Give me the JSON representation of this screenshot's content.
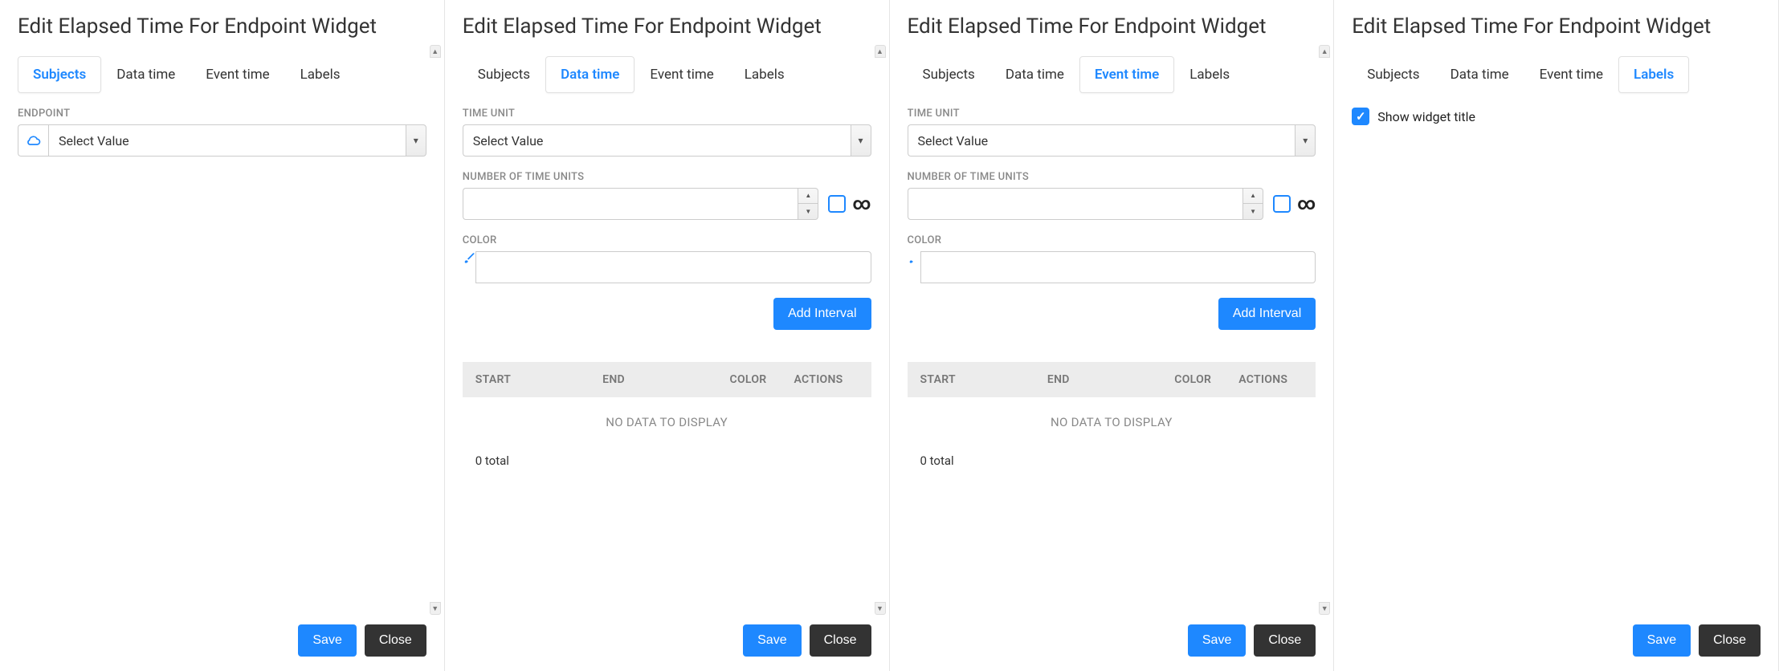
{
  "title": "Edit Elapsed Time For Endpoint Widget",
  "tabs": [
    "Subjects",
    "Data time",
    "Event time",
    "Labels"
  ],
  "panels": [
    {
      "activeTab": 0
    },
    {
      "activeTab": 1
    },
    {
      "activeTab": 2
    },
    {
      "activeTab": 3
    }
  ],
  "subjects": {
    "endpoint_label": "ENDPOINT",
    "endpoint_placeholder": "Select Value"
  },
  "timeForm": {
    "time_unit_label": "TIME UNIT",
    "time_unit_placeholder": "Select Value",
    "num_units_label": "NUMBER OF TIME UNITS",
    "num_units_value": "",
    "infinity_checked": false,
    "infinity_symbol": "∞",
    "color_label": "COLOR",
    "color_value": "",
    "add_interval_label": "Add Interval",
    "table": {
      "columns": [
        "START",
        "END",
        "COLOR",
        "ACTIONS"
      ],
      "empty_text": "NO DATA TO DISPLAY",
      "total_text": "0 total"
    }
  },
  "labels": {
    "show_widget_title_label": "Show widget title",
    "show_widget_title_checked": true
  },
  "buttons": {
    "save": "Save",
    "close": "Close"
  }
}
